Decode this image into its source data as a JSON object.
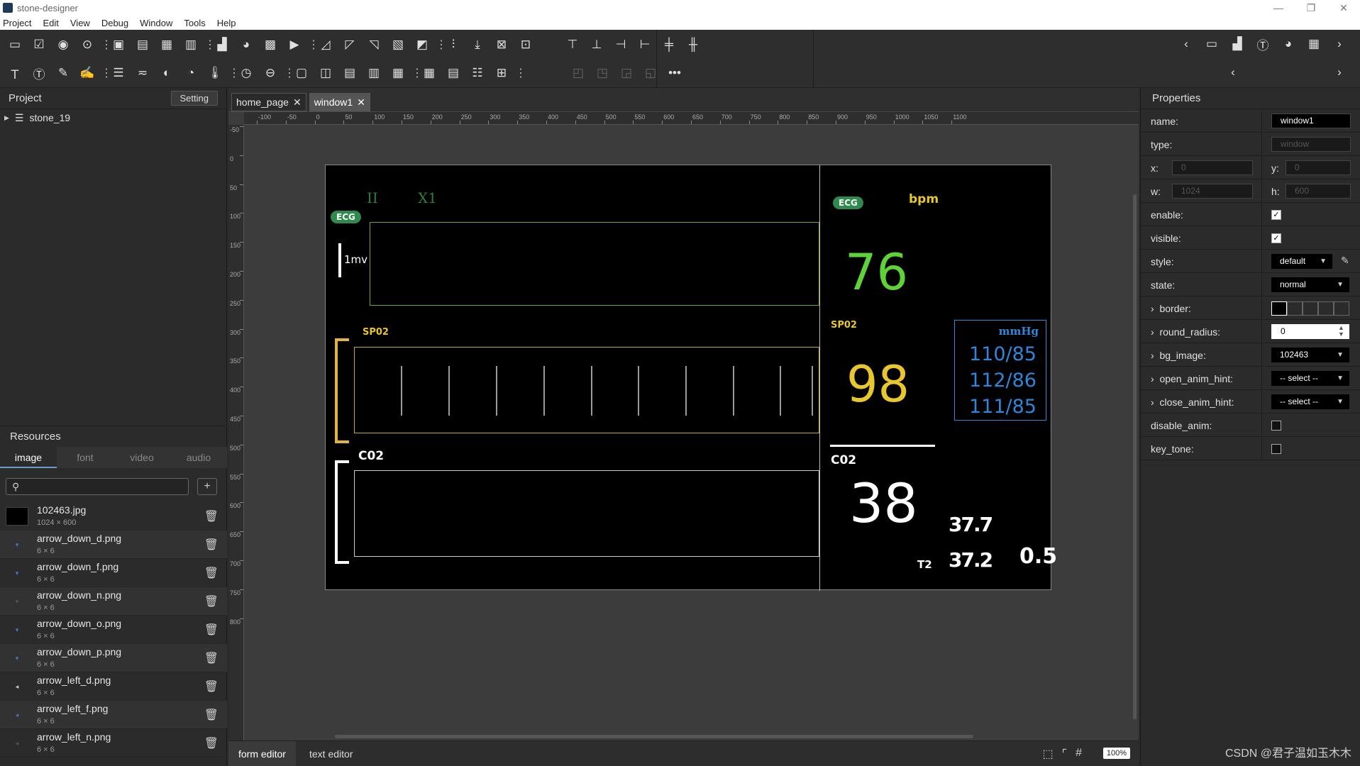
{
  "window": {
    "title": "stone-designer",
    "controls": [
      "—",
      "❐",
      "✕"
    ]
  },
  "menu": [
    "Project",
    "Edit",
    "View",
    "Debug",
    "Window",
    "Tools",
    "Help"
  ],
  "project_panel": {
    "title": "Project",
    "setting_label": "Setting",
    "tree": [
      {
        "label": "stone_19"
      }
    ]
  },
  "resources": {
    "title": "Resources",
    "tabs": [
      "image",
      "font",
      "video",
      "audio"
    ],
    "active_tab": "image",
    "add_label": "+",
    "items": [
      {
        "name": "102463.jpg",
        "size": "1024 × 600"
      },
      {
        "name": "arrow_down_d.png",
        "size": "6 × 6"
      },
      {
        "name": "arrow_down_f.png",
        "size": "6 × 6"
      },
      {
        "name": "arrow_down_n.png",
        "size": "6 × 6"
      },
      {
        "name": "arrow_down_o.png",
        "size": "6 × 6"
      },
      {
        "name": "arrow_down_p.png",
        "size": "6 × 6"
      },
      {
        "name": "arrow_left_d.png",
        "size": "6 × 6"
      },
      {
        "name": "arrow_left_f.png",
        "size": "6 × 6"
      },
      {
        "name": "arrow_left_n.png",
        "size": "6 × 6"
      }
    ]
  },
  "editor": {
    "tabs": [
      {
        "label": "home_page",
        "active": false
      },
      {
        "label": "window1",
        "active": true
      }
    ],
    "bottom_tabs": [
      "form editor",
      "text editor"
    ],
    "zoom": "100%",
    "ruler_h": [
      "-100",
      "-50",
      "0",
      "50",
      "100",
      "150",
      "200",
      "250",
      "300",
      "350",
      "400",
      "450",
      "500",
      "550",
      "600",
      "650",
      "700",
      "750",
      "800",
      "850",
      "900",
      "950",
      "1000",
      "1050",
      "1100"
    ],
    "ruler_v": [
      "-50",
      "0",
      "50",
      "100",
      "150",
      "200",
      "250",
      "300",
      "350",
      "400",
      "450",
      "500",
      "550",
      "600",
      "650",
      "700",
      "750",
      "800"
    ]
  },
  "monitor": {
    "lead_label": "II",
    "gain_label": "X1",
    "ecg_badge": "ECG",
    "scale_label": "1mv",
    "spo2_label": "SP02",
    "co2_label": "C02",
    "bpm_label": "bpm",
    "hr_value": "76",
    "spo2_value": "98",
    "nibp_unit": "mmHg",
    "nibp_values": [
      "110/85",
      "112/86",
      "111/85"
    ],
    "co2_value": "38",
    "t1_value": "37.7",
    "t2_label": "T2",
    "t2_value": "37.2",
    "extra_value": "0.5",
    "colors": {
      "hr": "#5fd23a",
      "spo2": "#e8c62e",
      "nibp": "#2f86d8",
      "ecg_badge": "#2e8b4d",
      "ecg_box": "#6aa832",
      "spo2_box": "#c9a83a"
    }
  },
  "properties": {
    "title": "Properties",
    "name": {
      "label": "name:",
      "value": "window1"
    },
    "type": {
      "label": "type:",
      "value": "window"
    },
    "x": {
      "label": "x:",
      "value": "0"
    },
    "y": {
      "label": "y:",
      "value": "0"
    },
    "w": {
      "label": "w:",
      "value": "1024"
    },
    "h": {
      "label": "h:",
      "value": "600"
    },
    "enable": {
      "label": "enable:",
      "checked": true
    },
    "visible": {
      "label": "visible:",
      "checked": true
    },
    "style": {
      "label": "style:",
      "value": "default"
    },
    "state": {
      "label": "state:",
      "value": "normal"
    },
    "border": {
      "label": "border:"
    },
    "round_radius": {
      "label": "round_radius:",
      "value": "0"
    },
    "bg_image": {
      "label": "bg_image:",
      "value": "102463"
    },
    "open_anim_hint": {
      "label": "open_anim_hint:",
      "value": "-- select --"
    },
    "close_anim_hint": {
      "label": "close_anim_hint:",
      "value": "-- select --"
    },
    "disable_anim": {
      "label": "disable_anim:",
      "checked": false
    },
    "key_tone": {
      "label": "key_tone:",
      "checked": false
    }
  },
  "watermark": "CSDN @君子温如玉木木"
}
